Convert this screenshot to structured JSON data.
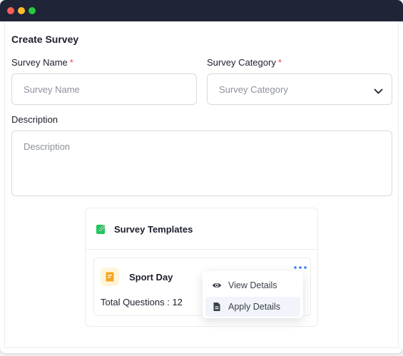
{
  "form": {
    "title": "Create Survey",
    "survey_name": {
      "label": "Survey Name",
      "required_mark": "*",
      "placeholder": "Survey Name"
    },
    "survey_category": {
      "label": "Survey Category",
      "required_mark": "*",
      "placeholder": "Survey Category"
    },
    "description": {
      "label": "Description",
      "placeholder": "Description"
    }
  },
  "templates": {
    "title": "Survey Templates",
    "items": [
      {
        "name": "Sport Day",
        "questions_label": "Total Questions : 12"
      }
    ]
  },
  "context_menu": {
    "items": [
      {
        "label": "View Details",
        "icon": "eye-icon"
      },
      {
        "label": "Apply Details",
        "icon": "document-icon"
      }
    ]
  },
  "colors": {
    "titlebar": "#1f2437",
    "required": "#ef4444",
    "templates_icon": "#22c55e",
    "item_icon": "#f5a623",
    "more_dots": "#3b82f6"
  }
}
